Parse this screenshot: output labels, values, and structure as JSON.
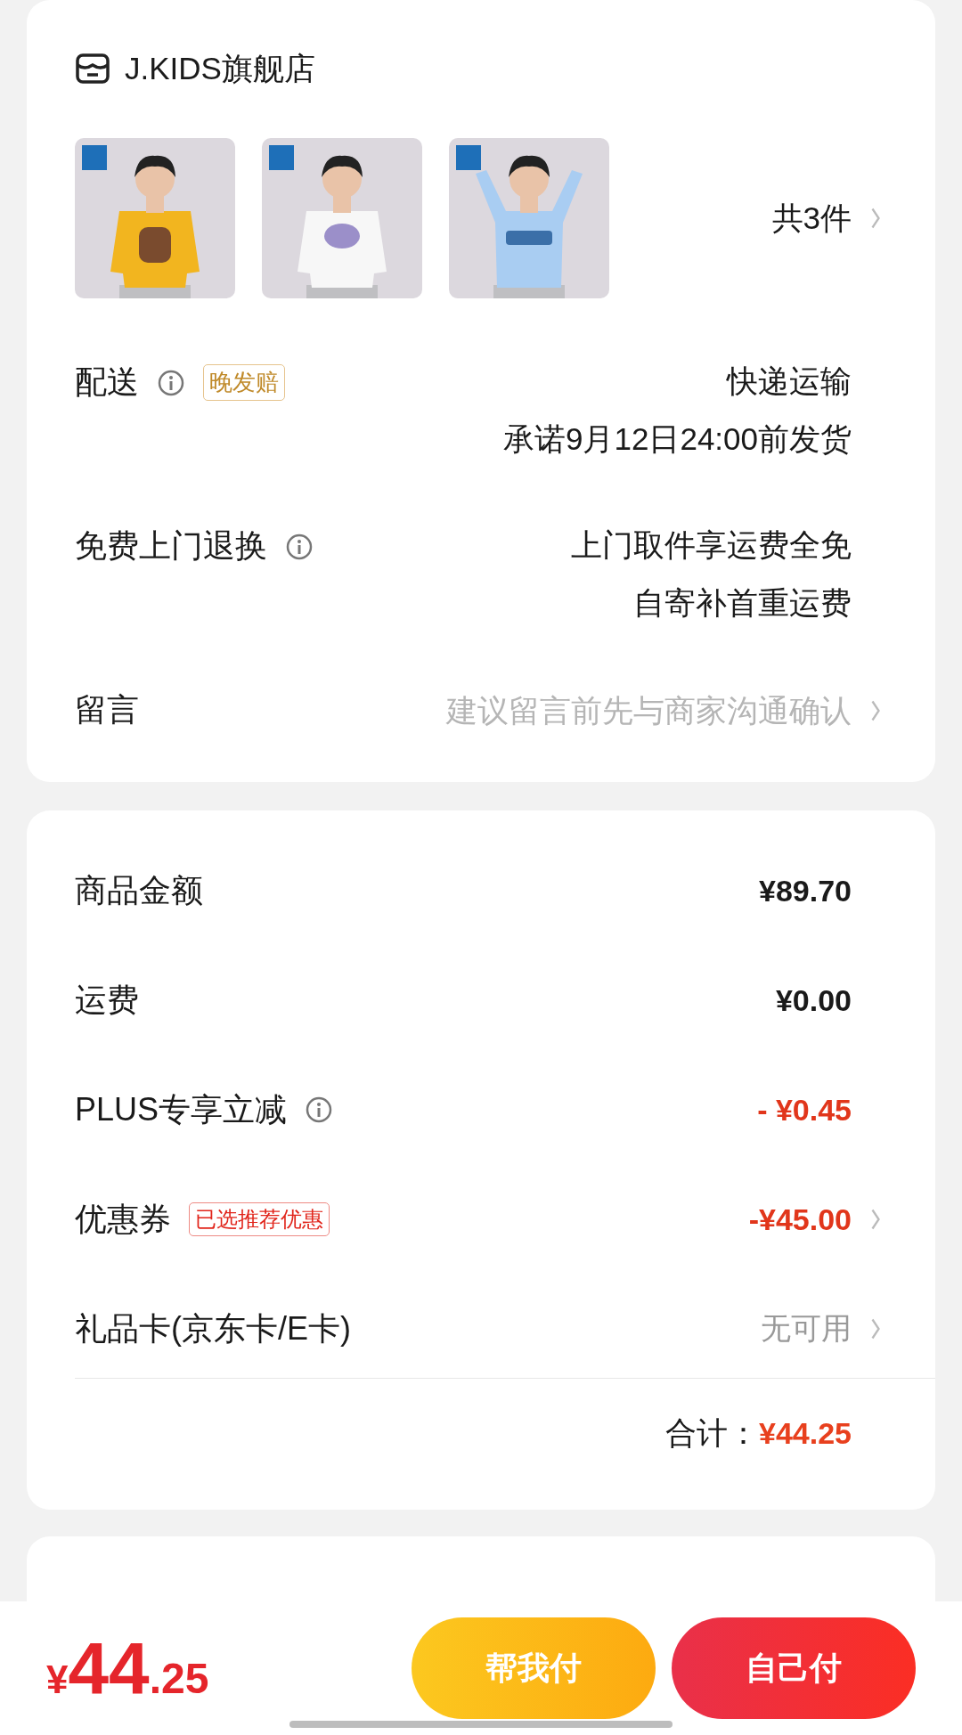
{
  "store": {
    "name": "J.KIDS旗舰店"
  },
  "product_count": "共3件",
  "delivery": {
    "label": "配送",
    "tag": "晚发赔",
    "lines": [
      "快递运输",
      "承诺9月12日24:00前发货"
    ]
  },
  "returns": {
    "label": "免费上门退换",
    "lines": [
      "上门取件享运费全免",
      "自寄补首重运费"
    ]
  },
  "message": {
    "label": "留言",
    "placeholder": "建议留言前先与商家沟通确认"
  },
  "costs": [
    {
      "label": "商品金额",
      "value": "¥89.70",
      "kind": "plain",
      "info": false,
      "chevron": false
    },
    {
      "label": "运费",
      "value": "¥0.00",
      "kind": "plain",
      "info": false,
      "chevron": false
    },
    {
      "label": "PLUS专享立减",
      "value": "- ¥0.45",
      "kind": "discount",
      "info": true,
      "chevron": false
    },
    {
      "label": "优惠券",
      "tag": "已选推荐优惠",
      "value": "-¥45.00",
      "kind": "discount",
      "info": false,
      "chevron": true
    },
    {
      "label": "礼品卡(京东卡/E卡)",
      "value": "无可用",
      "kind": "muted",
      "info": false,
      "chevron": true
    }
  ],
  "total": {
    "label": "合计：",
    "value": "¥44.25"
  },
  "bottom_bar": {
    "currency": "¥",
    "integer": "44",
    "decimal": ".25",
    "buttons": [
      {
        "label": "帮我付",
        "kind": "secondary"
      },
      {
        "label": "自己付",
        "kind": "primary"
      }
    ]
  }
}
